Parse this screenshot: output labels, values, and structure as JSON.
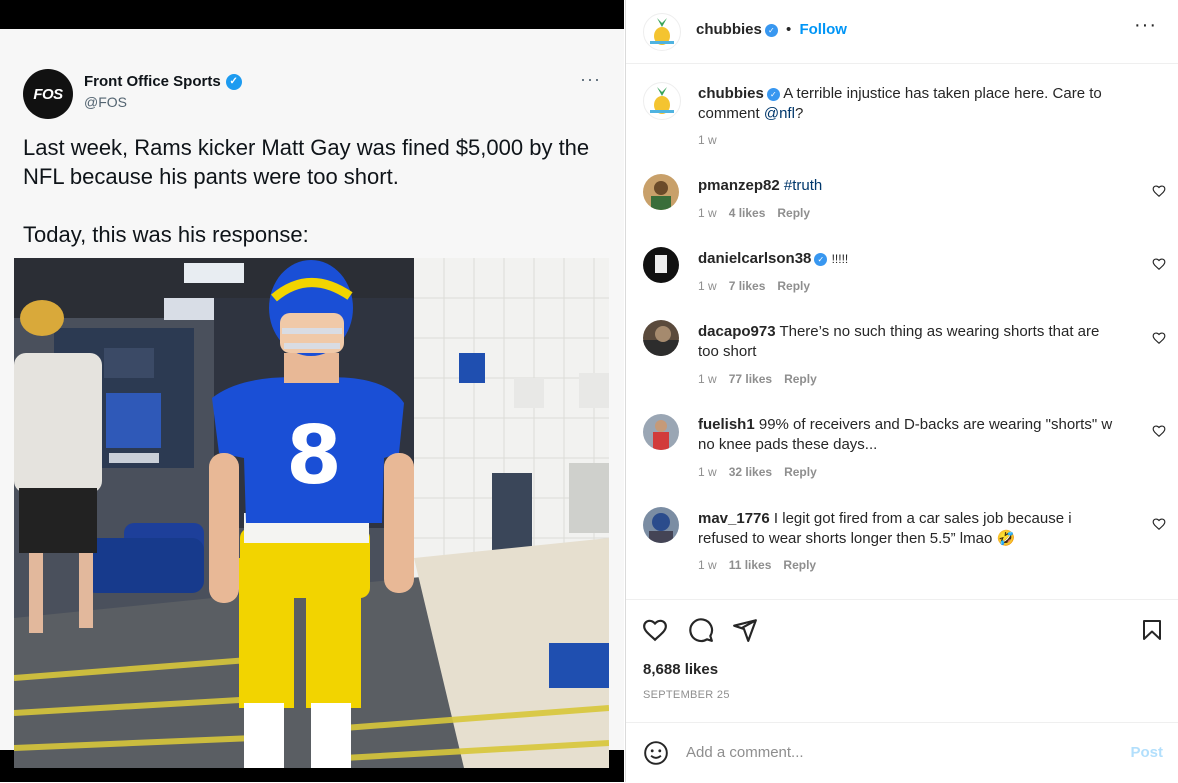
{
  "tweet": {
    "author_name": "Front Office Sports",
    "author_handle": "@FOS",
    "avatar_text": "FOS",
    "text": "Last week, Rams kicker Matt Gay was fined $5,000 by the NFL because his pants were too short.\n\nToday, this was his response:",
    "more": "···",
    "jersey_number": "8"
  },
  "post": {
    "username": "chubbies",
    "follow_label": "Follow",
    "separator": "•",
    "more": "···",
    "caption": {
      "username": "chubbies",
      "text_before": "A terrible injustice has taken place here. Care to comment ",
      "mention": "@nfl",
      "text_after": "?",
      "time": "1 w"
    },
    "comments": [
      {
        "username": "pmanzep82",
        "text": "",
        "hashtag": "#truth",
        "time": "1 w",
        "likes": "4 likes",
        "reply": "Reply",
        "verified": false
      },
      {
        "username": "danielcarlson38",
        "text": "!!!!!",
        "hashtag": "",
        "time": "1 w",
        "likes": "7 likes",
        "reply": "Reply",
        "verified": true
      },
      {
        "username": "dacapo973",
        "text": "There’s no such thing as wearing shorts that are too short",
        "hashtag": "",
        "time": "1 w",
        "likes": "77 likes",
        "reply": "Reply",
        "verified": false
      },
      {
        "username": "fuelish1",
        "text": "99% of receivers and D-backs are wearing \"shorts\" w no knee pads these days...",
        "hashtag": "",
        "time": "1 w",
        "likes": "32 likes",
        "reply": "Reply",
        "verified": false
      },
      {
        "username": "mav_1776",
        "text": "I legit got fired from a car sales job because i refused to wear shorts longer then 5.5” lmao 🤣",
        "hashtag": "",
        "time": "1 w",
        "likes": "11 likes",
        "reply": "Reply",
        "verified": false
      }
    ],
    "likes_count": "8,688 likes",
    "date": "SEPTEMBER 25",
    "add_comment_placeholder": "Add a comment...",
    "post_label": "Post"
  },
  "colors": {
    "link_blue": "#0095f6",
    "rams_blue": "#1a4fd6",
    "rams_yellow": "#f2d400"
  }
}
